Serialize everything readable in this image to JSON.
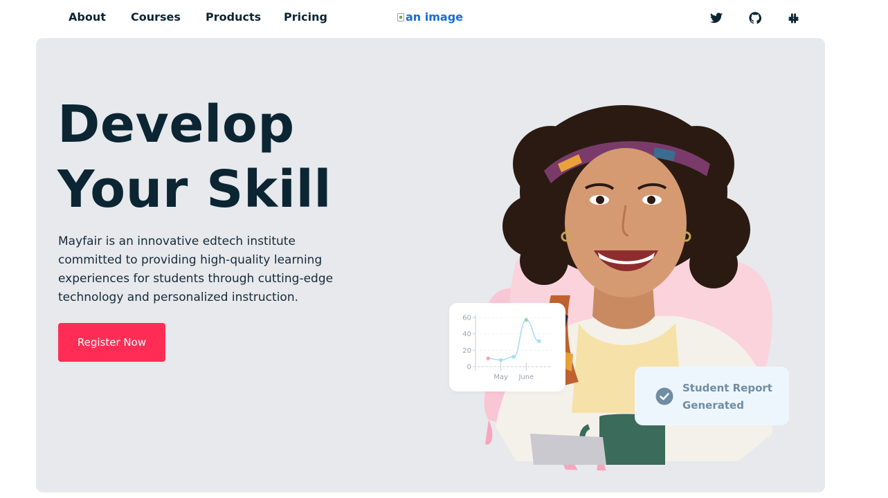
{
  "nav": {
    "links": [
      "About",
      "Courses",
      "Products",
      "Pricing"
    ],
    "logo_alt": "an image",
    "social": [
      "twitter-icon",
      "github-icon",
      "slack-icon"
    ]
  },
  "hero": {
    "headline_line1": "Develop",
    "headline_line2": "Your Skill",
    "description": "Mayfair is an innovative edtech institute committed to providing high-quality learning experiences for students through cutting-edge technology and personalized instruction.",
    "cta_label": "Register Now"
  },
  "chart_card": {
    "y_ticks": [
      "60",
      "40",
      "20",
      "0"
    ],
    "x_labels": [
      "May",
      "June"
    ]
  },
  "chart_data": {
    "type": "line",
    "title": "",
    "xlabel": "",
    "ylabel": "",
    "ylim": [
      0,
      60
    ],
    "x": [
      1,
      2,
      3,
      4,
      5
    ],
    "x_tick_labels": [
      "May",
      "June"
    ],
    "y_ticks": [
      0,
      20,
      40,
      60
    ],
    "series": [
      {
        "values": [
          10,
          8,
          12,
          57,
          31
        ]
      }
    ]
  },
  "report_card": {
    "line1": "Student Report",
    "line2": "Generated",
    "icon": "check-circle-icon"
  },
  "colors": {
    "brand_dark": "#0b2533",
    "cta": "#ff2d55",
    "hero_bg": "#e7e9ec",
    "report_text": "#6f8da3",
    "report_bg": "#eef6fd",
    "chart_line": "#a9dcf5",
    "link_blue": "#1a6cd8"
  }
}
